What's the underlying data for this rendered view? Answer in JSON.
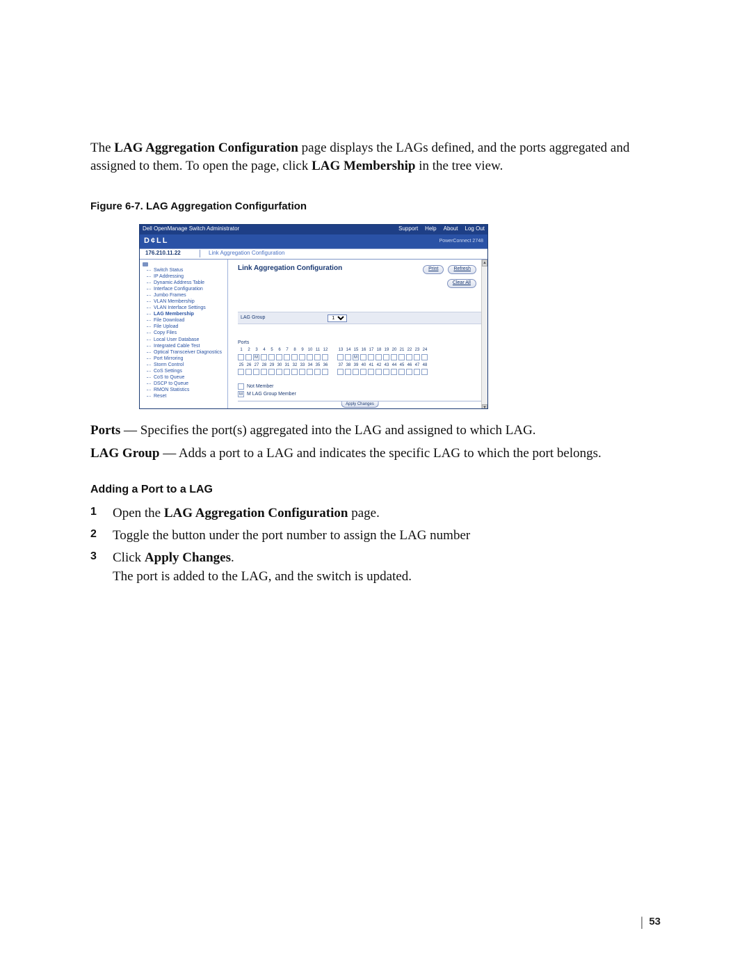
{
  "intro": {
    "prefix": "The ",
    "bold1": "LAG Aggregation Configuration",
    "mid1": " page displays the LAGs defined, and the ports aggregated and assigned to them. To open the page, click ",
    "bold2": "LAG Membership",
    "suffix": " in the tree view."
  },
  "figure_caption": "Figure 6-7.    LAG Aggregation Configurfation",
  "screenshot": {
    "app_title": "Dell OpenManage Switch Administrator",
    "nav": {
      "support": "Support",
      "help": "Help",
      "about": "About",
      "logout": "Log Out"
    },
    "brand": "D¢LL",
    "model": "PowerConnect 2748",
    "ip": "176.210.11.22",
    "breadcrumb": "Link Aggregation Configuration",
    "main_title": "Link Aggregation Configuration",
    "buttons": {
      "print": "Print",
      "refresh": "Refresh",
      "clear_all": "Clear All"
    },
    "lag_group_label": "LAG Group",
    "lag_group_value": "1",
    "ports_label": "Ports",
    "port_rows": {
      "r1a": [
        "1",
        "2",
        "3",
        "4",
        "5",
        "6",
        "7",
        "8",
        "9",
        "10",
        "11",
        "12"
      ],
      "r1b": [
        "13",
        "14",
        "15",
        "16",
        "17",
        "18",
        "19",
        "20",
        "21",
        "22",
        "23",
        "24"
      ],
      "r2a": [
        "25",
        "26",
        "27",
        "28",
        "29",
        "30",
        "31",
        "32",
        "33",
        "34",
        "35",
        "36"
      ],
      "r2b": [
        "37",
        "38",
        "39",
        "40",
        "41",
        "42",
        "43",
        "44",
        "45",
        "46",
        "47",
        "48"
      ]
    },
    "port_member_r1": [
      false,
      false,
      true,
      false,
      false,
      false,
      false,
      false,
      false,
      false,
      false,
      false
    ],
    "port_member_r1b": [
      false,
      false,
      true,
      false,
      false,
      false,
      false,
      false,
      false,
      false,
      false,
      false
    ],
    "legend": {
      "not_member": "Not Member",
      "member": "M LAG Group Member"
    },
    "apply": "Apply Changes",
    "tree": [
      "Switch Status",
      "IP Addressing",
      "Dynamic Address Table",
      "Interface Configuration",
      "Jumbo Frames",
      "VLAN Membership",
      "VLAN Interface Settings",
      "LAG Membership",
      "File Download",
      "File Upload",
      "Copy Files",
      "Local User Database",
      "Integrated Cable Test",
      "Optical Transceiver Diagnostics",
      "Port Mirroring",
      "Storm Control",
      "CoS Settings",
      "CoS to Queue",
      "DSCP to Queue",
      "RMON Statistics",
      "Reset"
    ],
    "tree_selected": "LAG Membership"
  },
  "defs": {
    "ports_term": "Ports",
    "ports_def": " — Specifies the port(s) aggregated into the LAG and assigned to which LAG.",
    "lag_term": "LAG Group",
    "lag_def": " — Adds a port to a LAG and indicates the specific LAG to which the port belongs."
  },
  "subhead": "Adding a Port to a LAG",
  "steps": {
    "s1_a": "Open the ",
    "s1_b": "LAG Aggregation Configuration",
    "s1_c": " page.",
    "s2": "Toggle the button under the port number to assign the LAG number",
    "s3_a": "Click ",
    "s3_b": "Apply Changes",
    "s3_c": ".",
    "s3_d": "The port is added to the LAG, and the switch is updated."
  },
  "page_number": "53"
}
